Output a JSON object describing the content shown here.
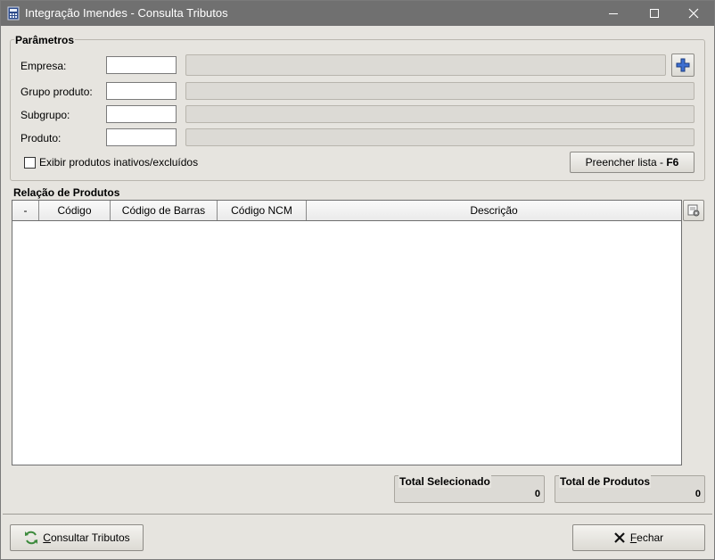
{
  "window": {
    "title": "Integração Imendes - Consulta Tributos",
    "controls": {
      "minimize": "minimize-icon",
      "maximize": "maximize-icon",
      "close": "close-icon"
    }
  },
  "parametros": {
    "legend": "Parâmetros",
    "fields": {
      "empresa": {
        "label": "Empresa:",
        "code": "",
        "description": ""
      },
      "grupo": {
        "label": "Grupo produto:",
        "code": "",
        "description": ""
      },
      "subgrupo": {
        "label": "Subgrupo:",
        "code": "",
        "description": ""
      },
      "produto": {
        "label": "Produto:",
        "code": "",
        "description": ""
      }
    },
    "inativos_checkbox": {
      "label": "Exibir produtos inativos/excluídos",
      "checked": false
    },
    "preencher_button": {
      "label": "Preencher lista - ",
      "shortcut": "F6"
    }
  },
  "relacao": {
    "legend": "Relação de Produtos",
    "columns": [
      "-",
      "Código",
      "Código de Barras",
      "Código NCM",
      "Descrição"
    ],
    "rows": []
  },
  "totals": {
    "selecionado": {
      "label": "Total Selecionado",
      "value": "0"
    },
    "produtos": {
      "label": "Total de Produtos",
      "value": "0"
    }
  },
  "footer": {
    "consultar": {
      "prefix": "C",
      "rest": "onsultar Tributos",
      "icon": "refresh-icon"
    },
    "fechar": {
      "prefix": "F",
      "rest": "echar",
      "icon": "x-icon"
    }
  },
  "colors": {
    "titlebar": "#707070",
    "background": "#e6e4df",
    "readonly_field": "#dcdad5"
  }
}
